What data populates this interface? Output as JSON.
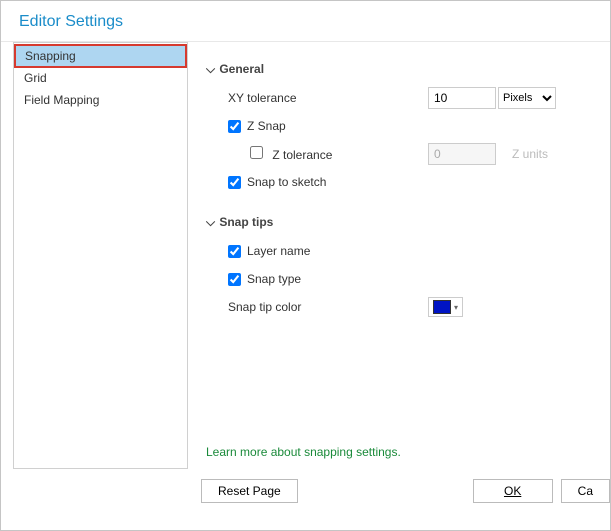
{
  "title": "Editor Settings",
  "sidebar": {
    "items": [
      {
        "label": "Snapping"
      },
      {
        "label": "Grid"
      },
      {
        "label": "Field Mapping"
      }
    ]
  },
  "sections": {
    "general": {
      "header": "General",
      "xy_tolerance_label": "XY tolerance",
      "xy_tolerance_value": "10",
      "xy_units_options": [
        "Pixels"
      ],
      "xy_units_selected": "Pixels",
      "z_snap_label": "Z Snap",
      "z_snap_checked": true,
      "z_tolerance_label": "Z tolerance",
      "z_tolerance_checked": false,
      "z_tolerance_value": "0",
      "z_units_label": "Z units",
      "snap_sketch_label": "Snap to sketch",
      "snap_sketch_checked": true
    },
    "snaptips": {
      "header": "Snap tips",
      "layer_name_label": "Layer name",
      "layer_name_checked": true,
      "snap_type_label": "Snap type",
      "snap_type_checked": true,
      "snap_color_label": "Snap tip color",
      "snap_color_value": "#0014c4"
    }
  },
  "learn_more": "Learn more about snapping settings.",
  "footer": {
    "reset": "Reset Page",
    "ok": "OK",
    "cancel": "Cancel"
  }
}
